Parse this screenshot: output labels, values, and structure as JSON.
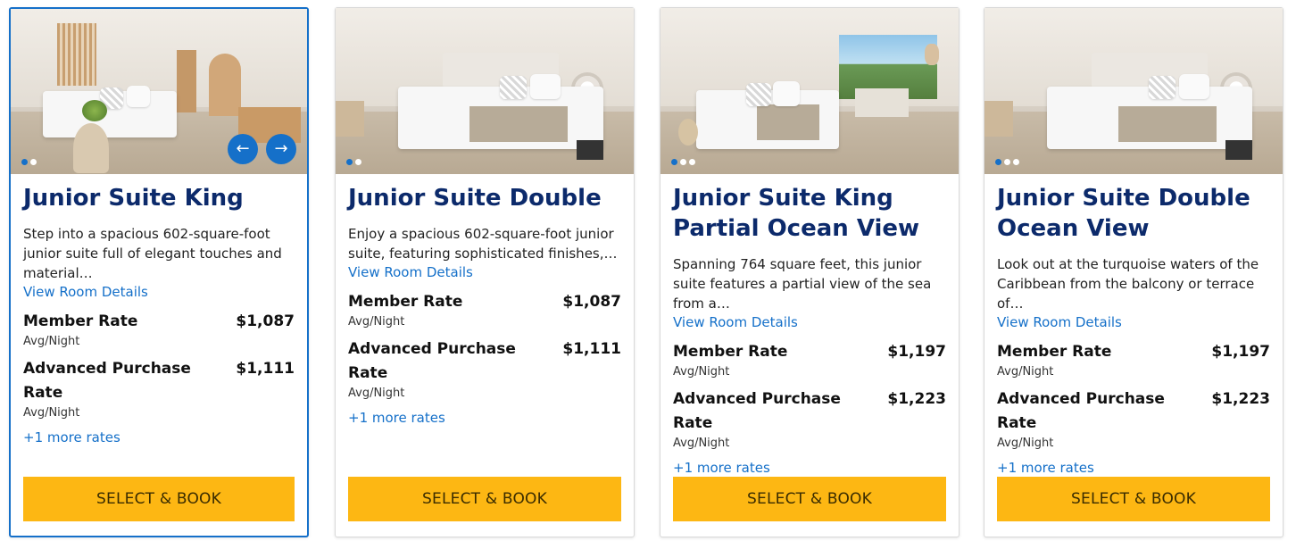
{
  "cards": [
    {
      "title": "Junior Suite King",
      "description": "Step into a spacious 602-square-foot junior suite full of elegant touches and material…",
      "details_link": "View Room Details",
      "rates": [
        {
          "name": "Member Rate",
          "price": "$1,087",
          "per": "Avg/Night"
        },
        {
          "name": "Advanced Purchase Rate",
          "price": "$1,111",
          "per": "Avg/Night"
        }
      ],
      "more_rates": "+1 more rates",
      "cta": "SELECT & BOOK",
      "carousel": {
        "dots": 2,
        "active": 1
      }
    },
    {
      "title": "Junior Suite Double",
      "description": "Enjoy a spacious 602-square-foot junior suite, featuring sophisticated finishes,…",
      "details_link": "View Room Details",
      "rates": [
        {
          "name": "Member Rate",
          "price": "$1,087",
          "per": "Avg/Night"
        },
        {
          "name": "Advanced Purchase Rate",
          "price": "$1,111",
          "per": "Avg/Night"
        }
      ],
      "more_rates": "+1 more rates",
      "cta": "SELECT & BOOK",
      "carousel": {
        "dots": 2,
        "active": 1
      }
    },
    {
      "title": "Junior Suite King Partial Ocean View",
      "description": "Spanning 764 square feet, this junior suite features a partial view of the sea from a…",
      "details_link": "View Room Details",
      "rates": [
        {
          "name": "Member Rate",
          "price": "$1,197",
          "per": "Avg/Night"
        },
        {
          "name": "Advanced Purchase Rate",
          "price": "$1,223",
          "per": "Avg/Night"
        }
      ],
      "more_rates": "+1 more rates",
      "cta": "SELECT & BOOK",
      "carousel": {
        "dots": 3,
        "active": 1
      }
    },
    {
      "title": "Junior Suite Double Ocean View",
      "description": "Look out at the turquoise waters of the Caribbean from the balcony or terrace of…",
      "details_link": "View Room Details",
      "rates": [
        {
          "name": "Member Rate",
          "price": "$1,197",
          "per": "Avg/Night"
        },
        {
          "name": "Advanced Purchase Rate",
          "price": "$1,223",
          "per": "Avg/Night"
        }
      ],
      "more_rates": "+1 more rates",
      "cta": "SELECT & BOOK",
      "carousel": {
        "dots": 3,
        "active": 1
      }
    }
  ],
  "colors": {
    "title": "#0c2a6b",
    "link": "#1570c9",
    "cta_background": "#fdb713",
    "active_border": "#1570c9"
  },
  "icons": {
    "prev": "arrow-left-icon",
    "next": "arrow-right-icon"
  }
}
